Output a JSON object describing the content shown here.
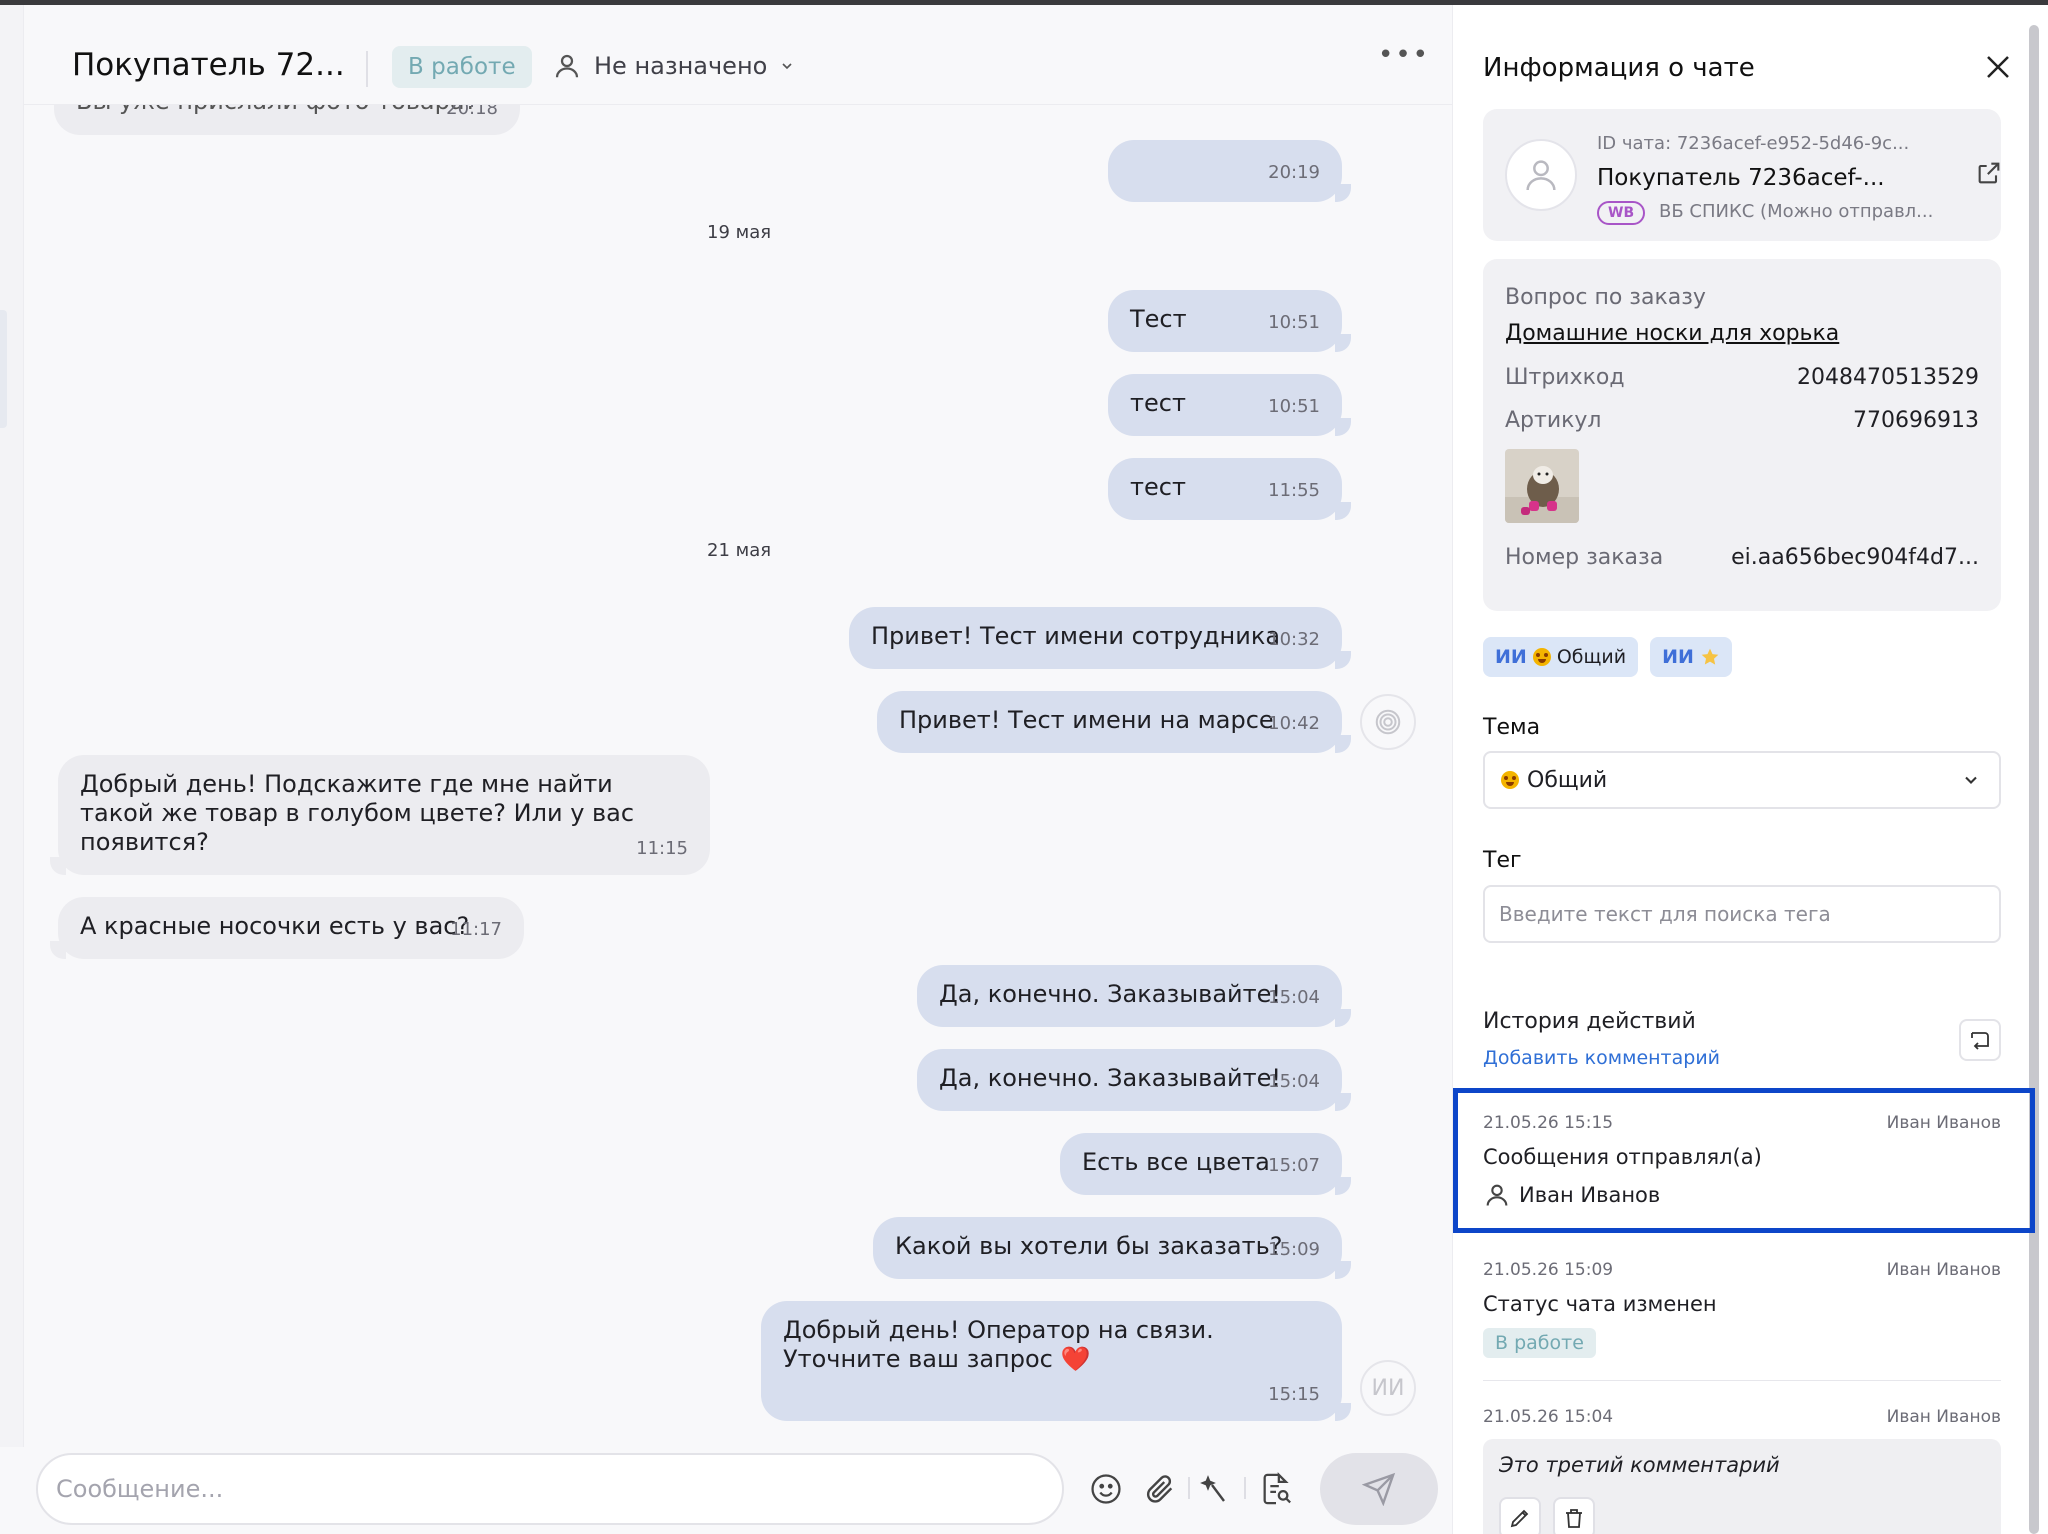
{
  "header": {
    "title": "Покупатель 72...",
    "status": "В работе",
    "assignee": "Не назначено",
    "more_label": "•••"
  },
  "messages": {
    "cut_top_text": "Вы уже прислали фото товара?",
    "cut_top_time": "20:18",
    "m1_time": "20:19",
    "date1": "19 мая",
    "m2_text": "Тест",
    "m2_time": "10:51",
    "m3_text": "тест",
    "m3_time": "10:51",
    "m4_text": "тест",
    "m4_time": "11:55",
    "date2": "21 мая",
    "m5_text": "Привет! Тест имени сотрудника",
    "m5_time": "10:32",
    "m6_text": "Привет! Тест имени на марсе",
    "m6_time": "10:42",
    "m7_text": "Добрый день! Подскажите где мне найти такой же товар в голубом цвете? Или у вас появится?",
    "m7_time": "11:15",
    "m8_text": "А красные носочки есть у вас?",
    "m8_time": "11:17",
    "m9_text": "Да, конечно. Заказывайте!",
    "m9_time": "15:04",
    "m10_text": "Да, конечно. Заказывайте!",
    "m10_time": "15:04",
    "m11_text": "Есть все цвета",
    "m11_time": "15:07",
    "m12_text": "Какой вы хотели бы заказать?",
    "m12_time": "15:09",
    "m13_text": "Добрый день! Оператор на связи. Уточните ваш запрос ❤️",
    "m13_time": "15:15",
    "ai_avatar": "ИИ"
  },
  "composer": {
    "placeholder": "Сообщение..."
  },
  "info": {
    "title": "Информация о чате",
    "chat_id": "ID чата: 7236acef-e952-5d46-9c...",
    "buyer_name": "Покупатель 7236acef-...",
    "marketplace_badge": "WB",
    "store_name": "ВБ СПИКС (Можно отправл...",
    "order": {
      "question_label": "Вопрос по заказу",
      "product": "Домашние носки для хорька",
      "barcode_label": "Штрихкод",
      "barcode": "2048470513529",
      "article_label": "Артикул",
      "article": "770696913",
      "order_label": "Номер заказа",
      "order_number": "ei.aa656bec904f4d7..."
    },
    "chips": [
      {
        "ai": "ИИ",
        "text": "Общий"
      },
      {
        "ai": "ИИ",
        "text": ""
      }
    ],
    "topic_label": "Тема",
    "topic_value": "Общий",
    "tag_label": "Тег",
    "tag_placeholder": "Введите текст для поиска тега",
    "history_title": "История действий",
    "add_comment": "Добавить комментарий",
    "history": [
      {
        "date": "21.05.26 15:15",
        "author": "Иван Иванов",
        "action": "Сообщения отправлял(а)",
        "user": "Иван Иванов"
      },
      {
        "date": "21.05.26 15:09",
        "author": "Иван Иванов",
        "action": "Статус чата изменен",
        "status": "В работе"
      },
      {
        "date": "21.05.26 15:04",
        "author": "Иван Иванов",
        "comment": "Это третий комментарий"
      }
    ]
  },
  "colors": {
    "outgoing_bubble": "#d7deee",
    "incoming_bubble": "#ececf0",
    "status_text": "#73a9b2",
    "link": "#2f6fd6",
    "highlight": "#0d46c9"
  }
}
